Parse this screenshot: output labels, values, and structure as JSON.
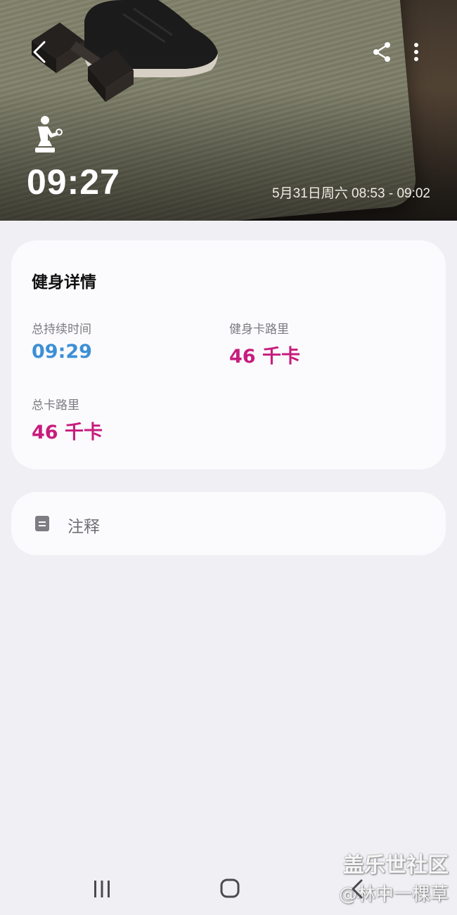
{
  "header": {
    "duration": "09:27",
    "date_range": "5月31日周六 08:53 - 09:02"
  },
  "icons": {
    "back": "chevron-left-icon",
    "share": "share-icon",
    "more": "more-vertical-icon",
    "workout": "fitness-person-icon",
    "note": "note-icon"
  },
  "details": {
    "title": "健身详情",
    "stats": [
      {
        "label": "总持续时间",
        "value": "09:29",
        "color": "#3d8fd6"
      },
      {
        "label": "健身卡路里",
        "value": "46 千卡",
        "color": "#c71c7d"
      },
      {
        "label": "总卡路里",
        "value": "46 千卡",
        "color": "#c71c7d"
      }
    ]
  },
  "notes": {
    "label": "注释"
  },
  "watermark": {
    "line1": "盖乐世社区",
    "line2": "@林中一棵草"
  }
}
